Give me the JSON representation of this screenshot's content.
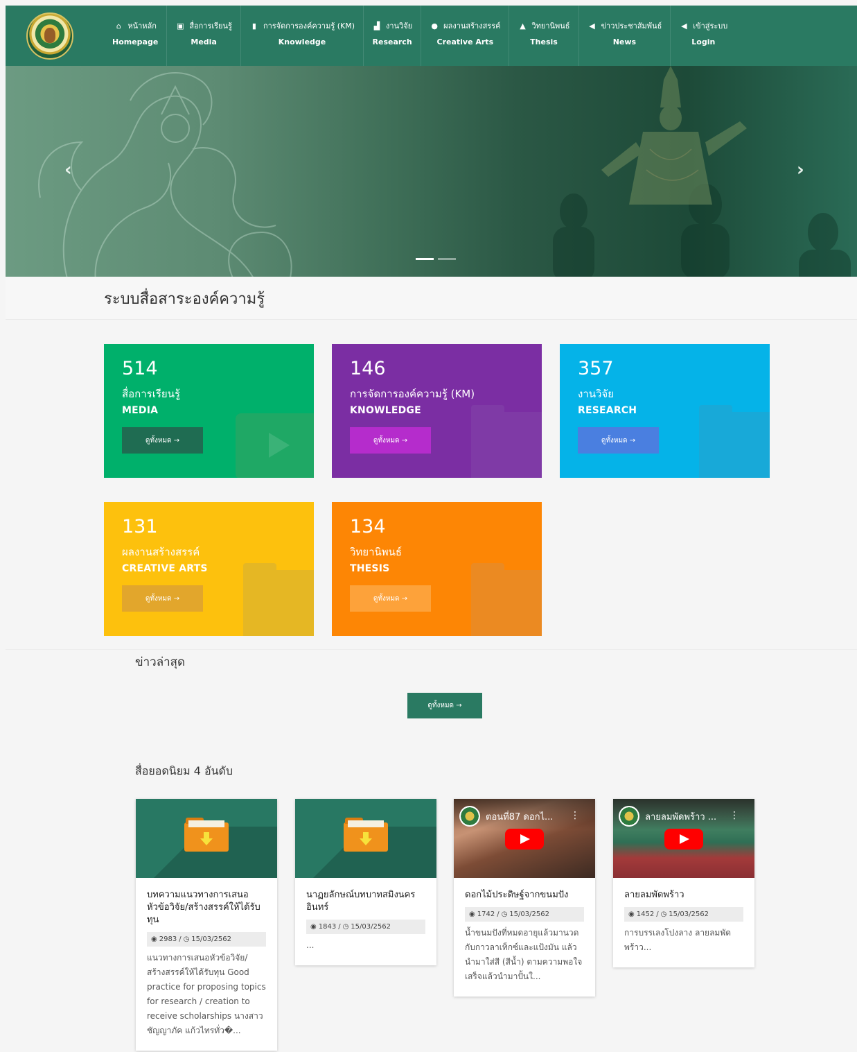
{
  "nav": {
    "items": [
      {
        "th": "หน้าหลัก",
        "en": "Homepage",
        "icon": "home-icon",
        "glyph": "⌂"
      },
      {
        "th": "สื่อการเรียนรู้",
        "en": "Media",
        "icon": "image-icon",
        "glyph": "▣"
      },
      {
        "th": "การจัดการองค์ความรู้ (KM)",
        "en": "Knowledge",
        "icon": "book-icon",
        "glyph": "▮"
      },
      {
        "th": "งานวิจัย",
        "en": "Research",
        "icon": "chart-icon",
        "glyph": "▟"
      },
      {
        "th": "ผลงานสร้างสรรค์",
        "en": "Creative Arts",
        "icon": "lightbulb-icon",
        "glyph": "●"
      },
      {
        "th": "วิทยานิพนธ์",
        "en": "Thesis",
        "icon": "graduation-cap-icon",
        "glyph": "▲"
      },
      {
        "th": "ข่าวประชาสัมพันธ์",
        "en": "News",
        "icon": "megaphone-icon",
        "glyph": "◀"
      },
      {
        "th": "เข้าสู่ระบบ",
        "en": "Login",
        "icon": "megaphone-icon",
        "glyph": "◀"
      }
    ]
  },
  "hero": {
    "prev": "‹",
    "next": "›"
  },
  "section_title": "ระบบสื่อสาระองค์ความรู้",
  "stats": [
    {
      "count": "514",
      "th": "สื่อการเรียนรู้",
      "en": "MEDIA",
      "button": "ดูทั้งหมด →",
      "color": "#00b06b"
    },
    {
      "count": "146",
      "th": "การจัดการองค์ความรู้ (KM)",
      "en": "KNOWLEDGE",
      "button": "ดูทั้งหมด →",
      "color": "#7b2ea3"
    },
    {
      "count": "357",
      "th": "งานวิจัย",
      "en": "RESEARCH",
      "button": "ดูทั้งหมด →",
      "color": "#05b3e8"
    },
    {
      "count": "131",
      "th": "ผลงานสร้างสรรค์",
      "en": "CREATIVE ARTS",
      "button": "ดูทั้งหมด →",
      "color": "#fdc10d"
    },
    {
      "count": "134",
      "th": "วิทยานิพนธ์",
      "en": "THESIS",
      "button": "ดูทั้งหมด →",
      "color": "#fd8605"
    }
  ],
  "news": {
    "title": "ข่าวล่าสุด",
    "button": "ดูทั้งหมด →"
  },
  "popular": {
    "title": "สื่อยอดนิยม 4 อันดับ",
    "items": [
      {
        "title": "บทความแนวทางการเสนอหัวข้อวิจัย/สร้างสรรค์ให้ได้รับทุน",
        "views": "2983",
        "date": "15/03/2562",
        "desc": "แนวทางการเสนอหัวข้อวิจัย/สร้างสรรค์ให้ได้รับทุน Good practice for proposing topics for research / creation to receive scholarships นางสาวชัญญาภัค แก้วไทรทั่ว�..."
      },
      {
        "title": "นาฏยลักษณ์บทบาทสมิงนครอินทร์",
        "views": "1843",
        "date": "15/03/2562",
        "desc": "..."
      },
      {
        "title": "ดอกไม้ประดิษฐ์จากขนมปัง",
        "views": "1742",
        "date": "15/03/2562",
        "desc": "น้ำขนมปังที่หมดอายุแล้วมานวดกับกาวลาเท็กซ์และแป้งมัน แล้วนำมาใส่สี (สีน้ำ) ตามความพอใจ เสร็จแล้วนำมาปั้นใ...",
        "video_title": "ตอนที่87 ดอกไ..."
      },
      {
        "title": "ลายลมพัดพร้าว",
        "views": "1452",
        "date": "15/03/2562",
        "desc": "การบรรเลงโปงลาง ลายลมพัดพร้าว...",
        "video_title": "ลายลมพัดพร้าว ..."
      }
    ]
  }
}
